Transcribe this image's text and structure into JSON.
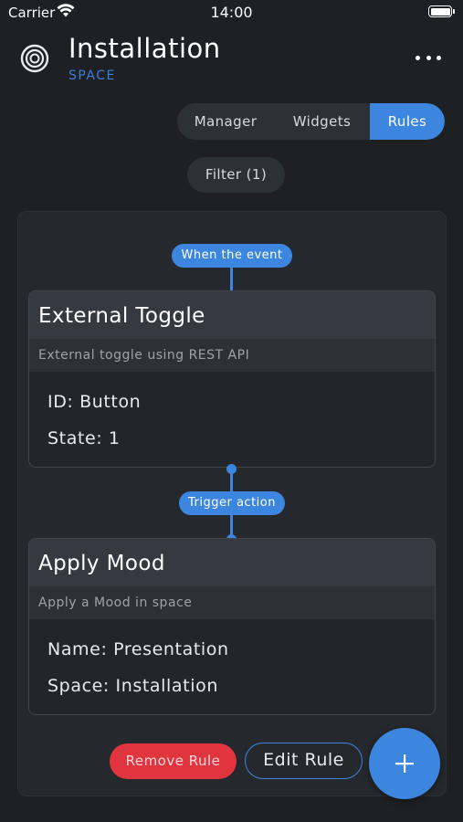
{
  "status_bar": {
    "carrier": "Carrier",
    "time": "14:00"
  },
  "header": {
    "title": "Installation",
    "subtitle": "SPACE",
    "logo_icon": "target-ring-icon",
    "more_icon": "ellipsis-icon"
  },
  "tabs": [
    {
      "label": "Manager",
      "active": false
    },
    {
      "label": "Widgets",
      "active": false
    },
    {
      "label": "Rules",
      "active": true
    }
  ],
  "filter": {
    "label": "Filter (1)"
  },
  "rule": {
    "event_label": "When the event",
    "action_label": "Trigger action",
    "event_card": {
      "title": "External Toggle",
      "description": "External toggle using REST API",
      "fields": [
        "ID: Button",
        "State: 1"
      ]
    },
    "action_card": {
      "title": "Apply Mood",
      "description": "Apply a Mood in space",
      "fields": [
        "Name: Presentation",
        "Space: Installation"
      ]
    }
  },
  "actions": {
    "remove_label": "Remove Rule",
    "edit_label": "Edit Rule",
    "add_icon": "plus-icon"
  },
  "colors": {
    "background": "#1e2024",
    "accent": "#3d86e0",
    "danger": "#e0353f"
  }
}
